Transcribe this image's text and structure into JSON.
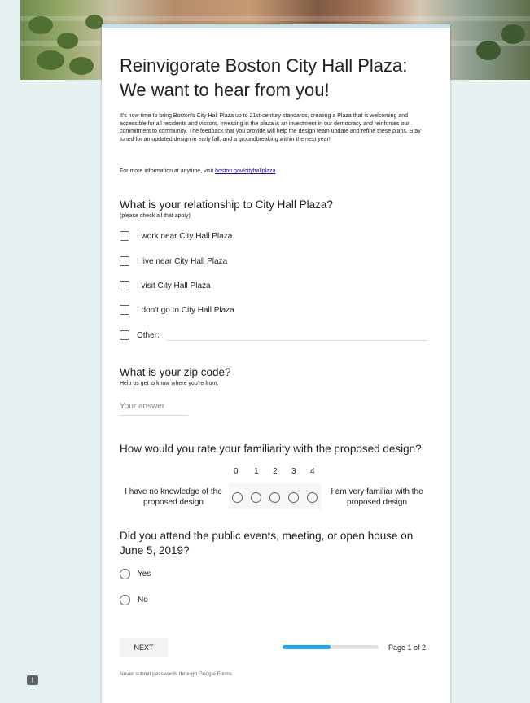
{
  "form": {
    "title": "Reinvigorate Boston City Hall Plaza: We want to hear from you!",
    "description": "It's now time to bring Boston's City Hall Plaza up to 21st-century standards, creating a Plaza that is welcoming and accessible for all residents and visitors. Investing in the plaza is an investment in our democracy and reinforces our commitment to community. The feedback that you provide will help the design team update and refine these plans. Stay tuned for an updated design in early fall, and a groundbreaking within the next year!",
    "info_prefix": "For more information at anytime, visit ",
    "info_link": "boston.gov/cityhallplaza"
  },
  "q1": {
    "title": "What is your relationship to City Hall Plaza?",
    "help": "(please check all that apply)",
    "options": [
      "I work near City Hall Plaza",
      "I live near City Hall Plaza",
      "I visit City Hall Plaza",
      "I don't go to City Hall Plaza"
    ],
    "other_label": "Other:"
  },
  "q2": {
    "title": "What is your zip code?",
    "help": "Help us get to know where you're from.",
    "placeholder": "Your answer"
  },
  "q3": {
    "title": "How would you rate your familiarity with the proposed design?",
    "scale": [
      "0",
      "1",
      "2",
      "3",
      "4"
    ],
    "low_label": "I have no knowledge of the proposed design",
    "high_label": "I am very familiar with the proposed design"
  },
  "q4": {
    "title": "Did you attend the public events, meeting, or open house on June 5, 2019?",
    "options": [
      "Yes",
      "No"
    ]
  },
  "footer": {
    "next_label": "NEXT",
    "progress_fraction": 0.5,
    "page_indicator": "Page 1 of 2",
    "notice": "Never submit passwords through Google Forms."
  },
  "icons": {
    "feedback": "report-icon"
  },
  "colors": {
    "progress": "#1ea4e9",
    "background": "#e6f1f2",
    "card_top": "#bfe3ee"
  }
}
